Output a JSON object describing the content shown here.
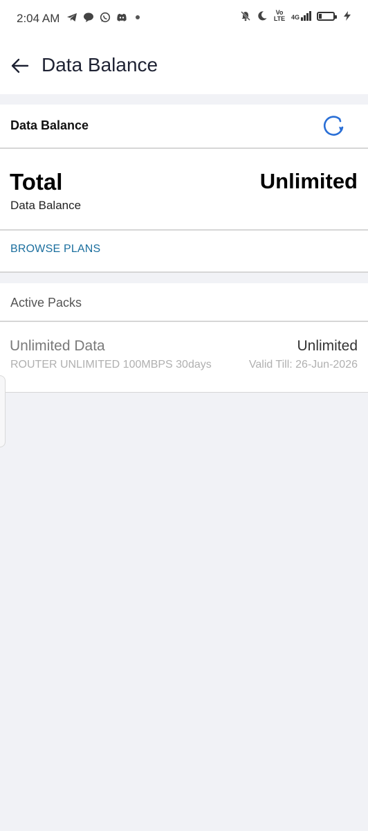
{
  "status_bar": {
    "time": "2:04 AM",
    "left_icons": [
      "telegram-icon",
      "chat-bubble-icon",
      "whatsapp-icon",
      "discord-icon",
      "notification-dot-icon"
    ],
    "right_icons": [
      "notifications-off-icon",
      "moon-icon",
      "volte-icon",
      "signal-4g-icon",
      "battery-icon",
      "charging-icon"
    ],
    "volte_label": "Vo\nLTE",
    "network_label": "4G"
  },
  "app_bar": {
    "back_icon": "arrow-left-icon",
    "title": "Data Balance"
  },
  "data_balance_card": {
    "header_title": "Data Balance",
    "refresh_icon": "refresh-icon",
    "accent_color": "#2a6fd6"
  },
  "total": {
    "label": "Total",
    "sub_label": "Data Balance",
    "value": "Unlimited"
  },
  "browse_plans": {
    "label": "BROWSE PLANS",
    "color": "#1a6e9e"
  },
  "active_packs": {
    "title": "Active Packs",
    "items": [
      {
        "name": "Unlimited Data",
        "value": "Unlimited",
        "description": "ROUTER UNLIMITED 100MBPS 30days",
        "valid_till": "Valid Till: 26-Jun-2026"
      }
    ]
  }
}
